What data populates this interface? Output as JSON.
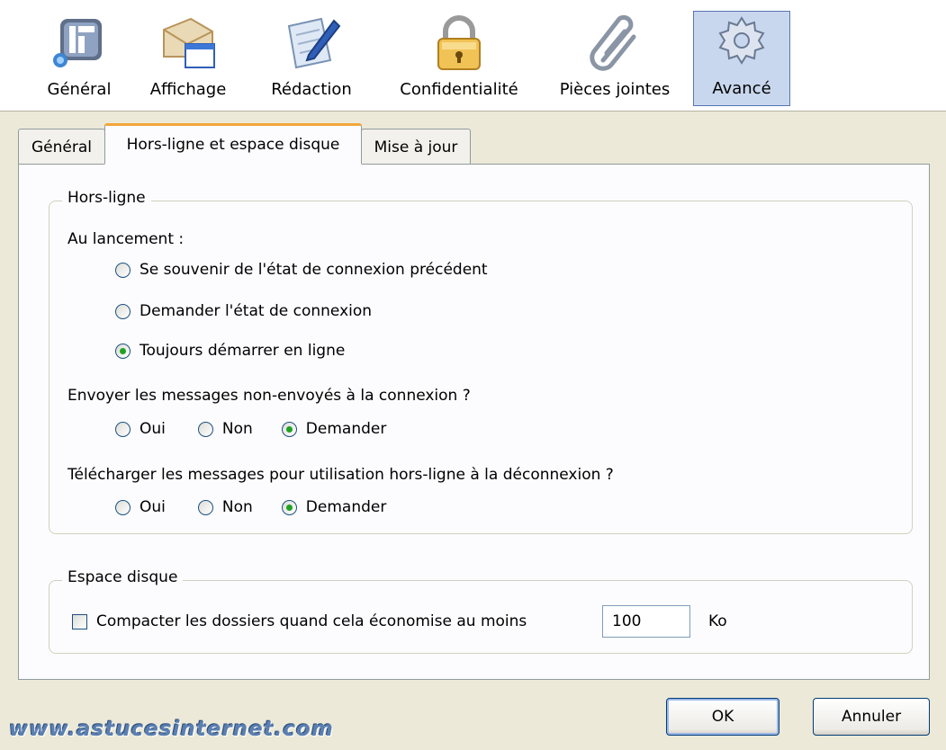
{
  "toolbar": {
    "items": [
      {
        "label": "Général",
        "icon": "general-icon"
      },
      {
        "label": "Affichage",
        "icon": "display-icon"
      },
      {
        "label": "Rédaction",
        "icon": "composition-icon"
      },
      {
        "label": "Confidentialité",
        "icon": "padlock-icon"
      },
      {
        "label": "Pièces jointes",
        "icon": "paperclip-icon"
      },
      {
        "label": "Avancé",
        "icon": "gear-icon"
      }
    ],
    "selected": "Avancé"
  },
  "tabs": [
    {
      "label": "Général"
    },
    {
      "label": "Hors-ligne et espace disque"
    },
    {
      "label": "Mise à jour"
    }
  ],
  "active_tab": "Hors-ligne et espace disque",
  "offline": {
    "caption": "Hors-ligne",
    "startup_label": "Au lancement :",
    "startup_options": [
      {
        "label": "Se souvenir de l'état de connexion précédent",
        "checked": false
      },
      {
        "label": "Demander l'état de connexion",
        "checked": false
      },
      {
        "label": "Toujours démarrer en ligne",
        "checked": true
      }
    ],
    "send_question": "Envoyer les messages non-envoyés à la connexion ?",
    "send_options": [
      {
        "label": "Oui",
        "checked": false
      },
      {
        "label": "Non",
        "checked": false
      },
      {
        "label": "Demander",
        "checked": true
      }
    ],
    "download_question": "Télécharger les messages pour utilisation hors-ligne à la déconnexion ?",
    "download_options": [
      {
        "label": "Oui",
        "checked": false
      },
      {
        "label": "Non",
        "checked": false
      },
      {
        "label": "Demander",
        "checked": true
      }
    ]
  },
  "disk": {
    "caption": "Espace disque",
    "compact_label": "Compacter les dossiers quand cela économise au moins",
    "compact_checked": false,
    "compact_value": "100",
    "unit": "Ko"
  },
  "buttons": {
    "ok": "OK",
    "cancel": "Annuler"
  },
  "watermark": "www.astucesinternet.com",
  "colors": {
    "accent_tab": "#f2a73b",
    "selected_bg": "#c9d7ee",
    "radio_dot": "#21a121"
  }
}
